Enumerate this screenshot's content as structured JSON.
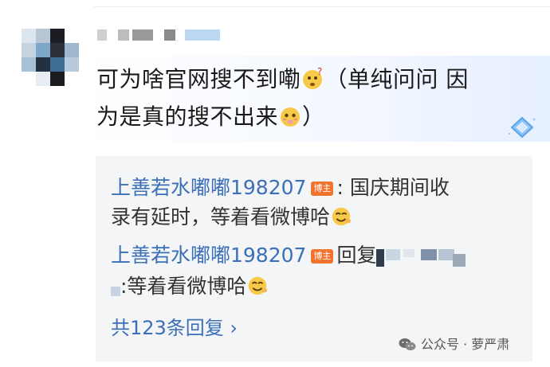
{
  "comment": {
    "text_line1": "可为啥官网搜不到嘞",
    "text_line1_tail": "（单纯问问 因",
    "text_line2": "为是真的搜不出来",
    "text_line2_tail": "）",
    "emoji1": "thinking-emoji",
    "emoji2": "pleading-emoji"
  },
  "replies": [
    {
      "author": "上善若水嘟嘟198207",
      "role_badge": "博主",
      "sep": ": ",
      "text_a": "国庆期间收",
      "text_b": "录有延时，等着看微博哈"
    },
    {
      "author": "上善若水嘟嘟198207",
      "role_badge": "博主",
      "reply_prefix": "回复",
      "text_b": ":等着看微博哈"
    }
  ],
  "more_replies": "共123条回复 ›",
  "watermark": "公众号 · 萝严肃",
  "colors": {
    "link_blue": "#3b6fb8",
    "badge_orange": "#f2732e",
    "panel_bg": "#f4f5f7"
  }
}
